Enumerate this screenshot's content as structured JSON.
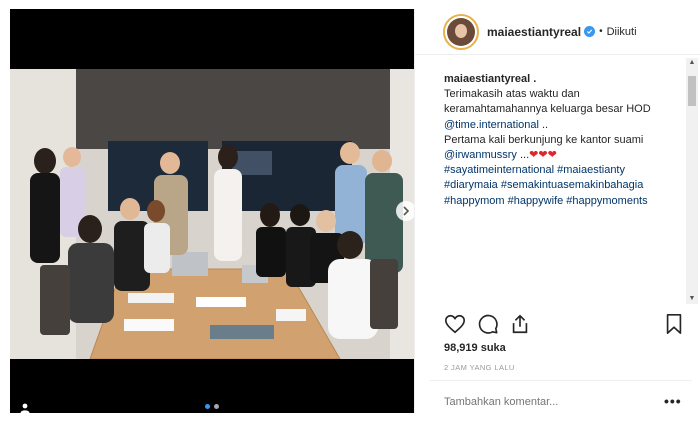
{
  "post": {
    "username": "maiaestiantyreal",
    "separator": "•",
    "follow_status": "Diikuti",
    "caption": {
      "username": "maiaestiantyreal .",
      "line1": "Terimakasih atas waktu dan",
      "line2": "keramahtamahannya keluarga besar HOD",
      "mention1": "@time.international",
      "after_mention1": " ..",
      "line4": "Pertama kali berkunjung ke kantor suami",
      "mention2": "@irwanmussry",
      "after_mention2": " ...",
      "hearts": "❤❤❤",
      "hashtags_line1": "#sayatimeinternational #maiaestianty",
      "hashtags_line2": "#diarymaia #semakintuasemakinbahagia",
      "hashtags_line3": "#happymom #happywife #happymoments"
    },
    "likes": "98,919 suka",
    "time_ago": "2 JAM YANG LALU",
    "comment_placeholder": "Tambahkan komentar...",
    "more_label": "•••",
    "carousel": {
      "current": 1,
      "total": 2
    }
  },
  "icons": {
    "like": "heart-outline-icon",
    "comment": "comment-bubble-icon",
    "share": "share-icon",
    "save": "bookmark-icon",
    "tag": "user-tag-icon",
    "next": "chevron-right-icon",
    "verified": "verified-badge-icon"
  },
  "colors": {
    "link": "#003569",
    "verified": "#3897f0",
    "heart": "#e0252b",
    "muted": "#999999"
  }
}
